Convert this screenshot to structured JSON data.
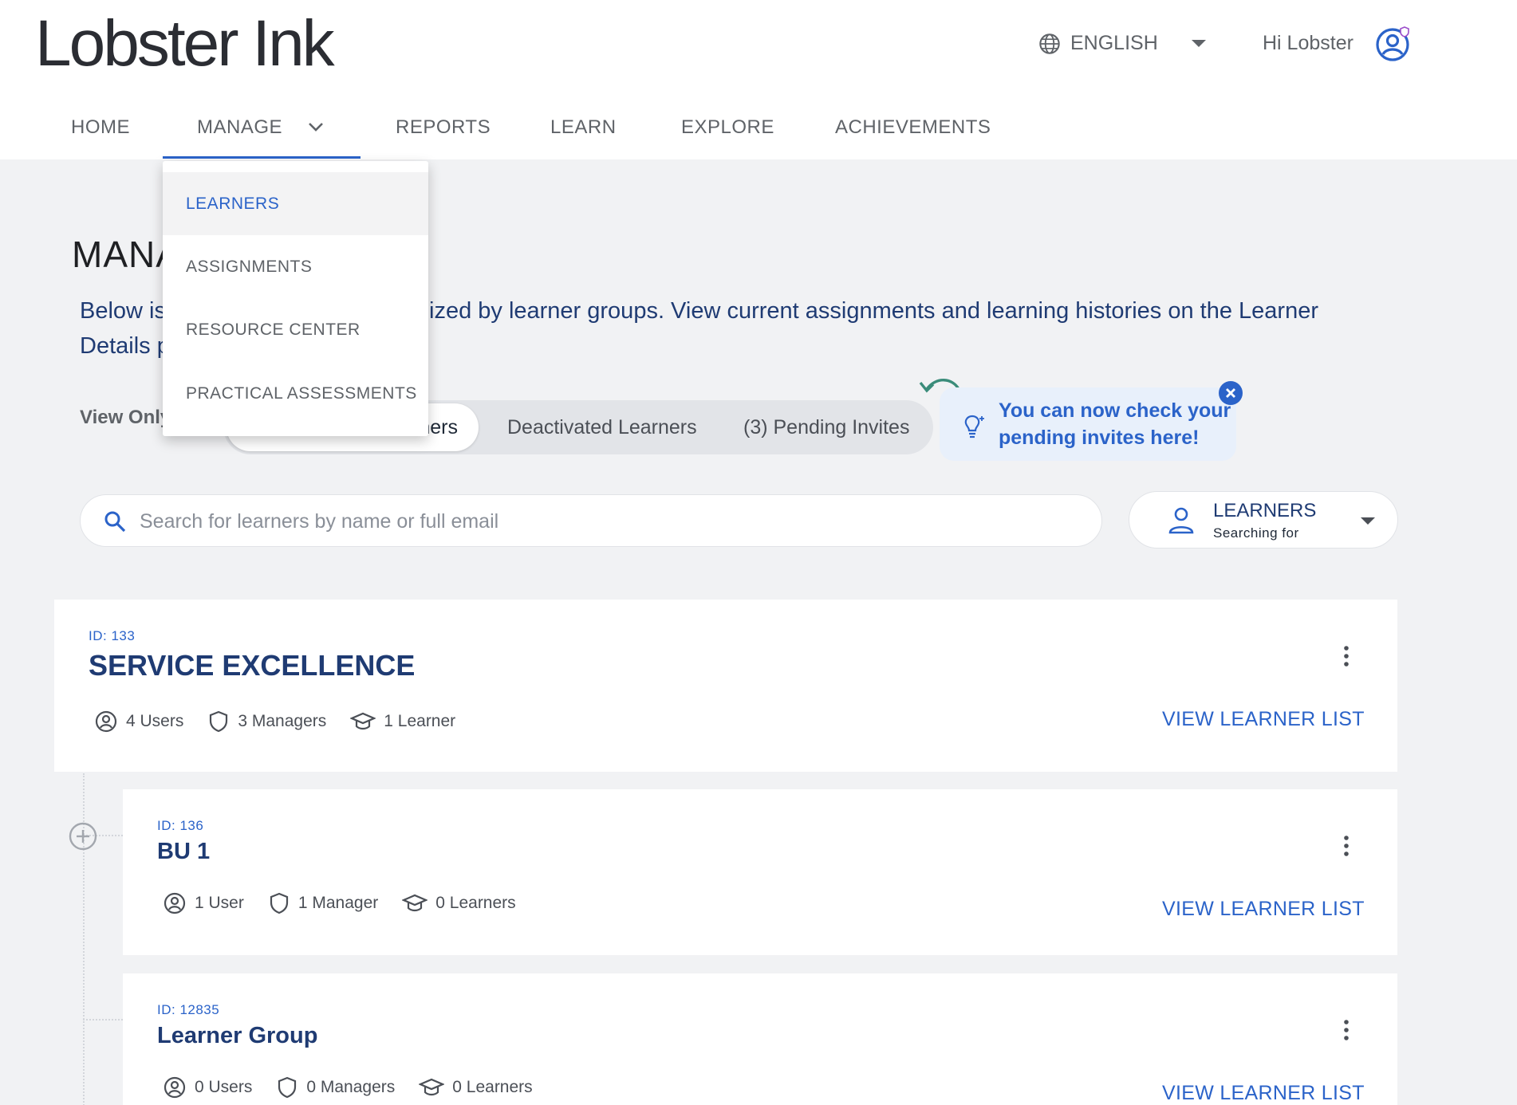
{
  "header": {
    "logo": "Lobster Ink",
    "language": "ENGLISH",
    "greeting": "Hi Lobster"
  },
  "nav": {
    "items": [
      {
        "label": "HOME"
      },
      {
        "label": "MANAGE"
      },
      {
        "label": "REPORTS"
      },
      {
        "label": "LEARN"
      },
      {
        "label": "EXPLORE"
      },
      {
        "label": "ACHIEVEMENTS"
      }
    ],
    "active": "MANAGE"
  },
  "manage_menu": {
    "items": [
      {
        "label": "LEARNERS",
        "active": true
      },
      {
        "label": "ASSIGNMENTS"
      },
      {
        "label": "RESOURCE CENTER"
      },
      {
        "label": "PRACTICAL ASSESSMENTS"
      }
    ]
  },
  "page": {
    "title_visible": "MANA",
    "description_part1": "Below is",
    "description_part1_end": "ized by learner groups. View current assignments and learning histories on the Learner",
    "description_part2": "Details p"
  },
  "view_filter": {
    "label": "View Only",
    "label_visible": "View Only",
    "options": [
      {
        "label_visible": "ners",
        "active": true
      },
      {
        "label": "Deactivated Learners"
      },
      {
        "label": "(3) Pending Invites"
      }
    ]
  },
  "hint": {
    "line1": "You can now check your",
    "line2": "pending invites here!"
  },
  "search": {
    "placeholder": "Search for learners by name or full email",
    "value": ""
  },
  "search_scope": {
    "value": "LEARNERS",
    "caption": "Searching for"
  },
  "groups": [
    {
      "id_label": "ID: 133",
      "name": "SERVICE EXCELLENCE",
      "users": "4 Users",
      "managers": "3 Managers",
      "learners": "1 Learner",
      "link": "VIEW LEARNER LIST"
    },
    {
      "id_label": "ID: 136",
      "name": "BU 1",
      "users": "1 User",
      "managers": "1 Manager",
      "learners": "0 Learners",
      "link": "VIEW LEARNER LIST"
    },
    {
      "id_label": "ID: 12835",
      "name": "Learner Group",
      "users": "0 Users",
      "managers": "0 Managers",
      "learners": "0 Learners",
      "link": "VIEW LEARNER LIST"
    }
  ],
  "colors": {
    "accent": "#2b63c9",
    "heading_navy": "#1f3b73",
    "background": "#f1f2f4"
  }
}
